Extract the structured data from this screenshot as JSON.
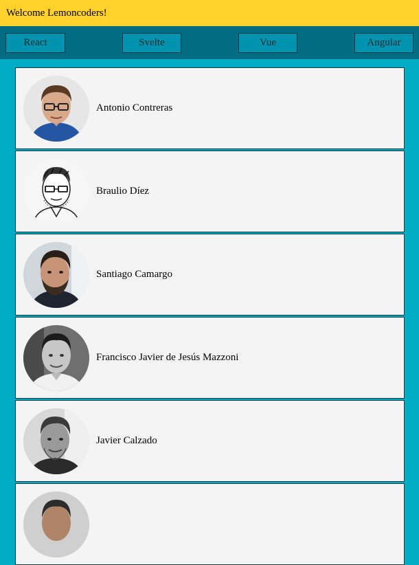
{
  "header": {
    "welcome_text": "Welcome Lemoncoders!"
  },
  "nav": {
    "buttons": [
      "React",
      "Svelte",
      "Vue",
      "Angular"
    ]
  },
  "members": [
    {
      "name": "Antonio Contreras",
      "avatar": "person-photo-glasses"
    },
    {
      "name": "Braulio Díez",
      "avatar": "person-sketch-drawing"
    },
    {
      "name": "Santiago Camargo",
      "avatar": "person-photo-beard"
    },
    {
      "name": "Francisco Javier de Jesús Mazzoni",
      "avatar": "person-photo-grayscale"
    },
    {
      "name": "Javier Calzado",
      "avatar": "person-photo-grayscale"
    },
    {
      "name": "",
      "avatar": "person-photo-partial"
    }
  ],
  "colors": {
    "header_bg": "#ffd12a",
    "nav_bg": "#006d84",
    "nav_button_bg": "#0093b0",
    "page_bg": "#00abc3",
    "card_bg": "#f4f4f4"
  }
}
